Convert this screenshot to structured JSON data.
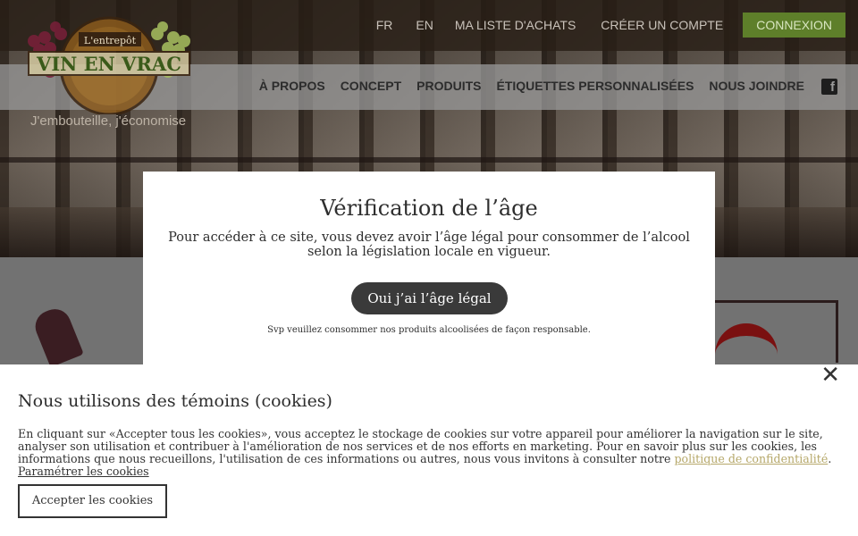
{
  "topbar": {
    "languages": [
      "FR",
      "EN"
    ],
    "shopping_list": "MA LISTE D'ACHATS",
    "create_account": "CRÉER UN COMPTE",
    "login": "CONNEXION"
  },
  "logo": {
    "small_text": "L'entrepôt",
    "big_text": "VIN EN VRAC"
  },
  "tagline": "J'embouteille, j'économise",
  "nav": {
    "items": [
      "À PROPOS",
      "CONCEPT",
      "PRODUITS",
      "ÉTIQUETTES PERSONNALISÉES",
      "NOUS JOINDRE"
    ],
    "social_icon": "facebook-icon"
  },
  "age_modal": {
    "title": "Vérification de l’âge",
    "text": "Pour accéder à ce site, vous devez avoir l’âge légal pour consommer de l’alcool selon la législation locale en vigueur.",
    "button": "Oui j’ai l’âge légal",
    "note": "Svp veuillez consommer nos produits alcoolisées de façon responsable."
  },
  "cookie_banner": {
    "title": "Nous utilisons des témoins (cookies)",
    "text": "En cliquant sur «Accepter tous les cookies», vous acceptez le stockage de cookies sur votre appareil pour améliorer la navigation sur le site, analyser son utilisation et contribuer à l'amélioration de nos services et de nos efforts en marketing. Pour en savoir plus sur les cookies, les informations que nous recueillons, l'utilisation de ces informations ou autres, nous vous invitons à consulter notre",
    "privacy_link": "politique de confidentialité",
    "settings_link": "Paramétrer les cookies",
    "accept_button": "Accepter les cookies",
    "close_icon": "close-icon"
  },
  "colors": {
    "login_button": "#5e7f2a",
    "modal_button": "#3a3a3a",
    "privacy_link": "#b6a86a"
  }
}
